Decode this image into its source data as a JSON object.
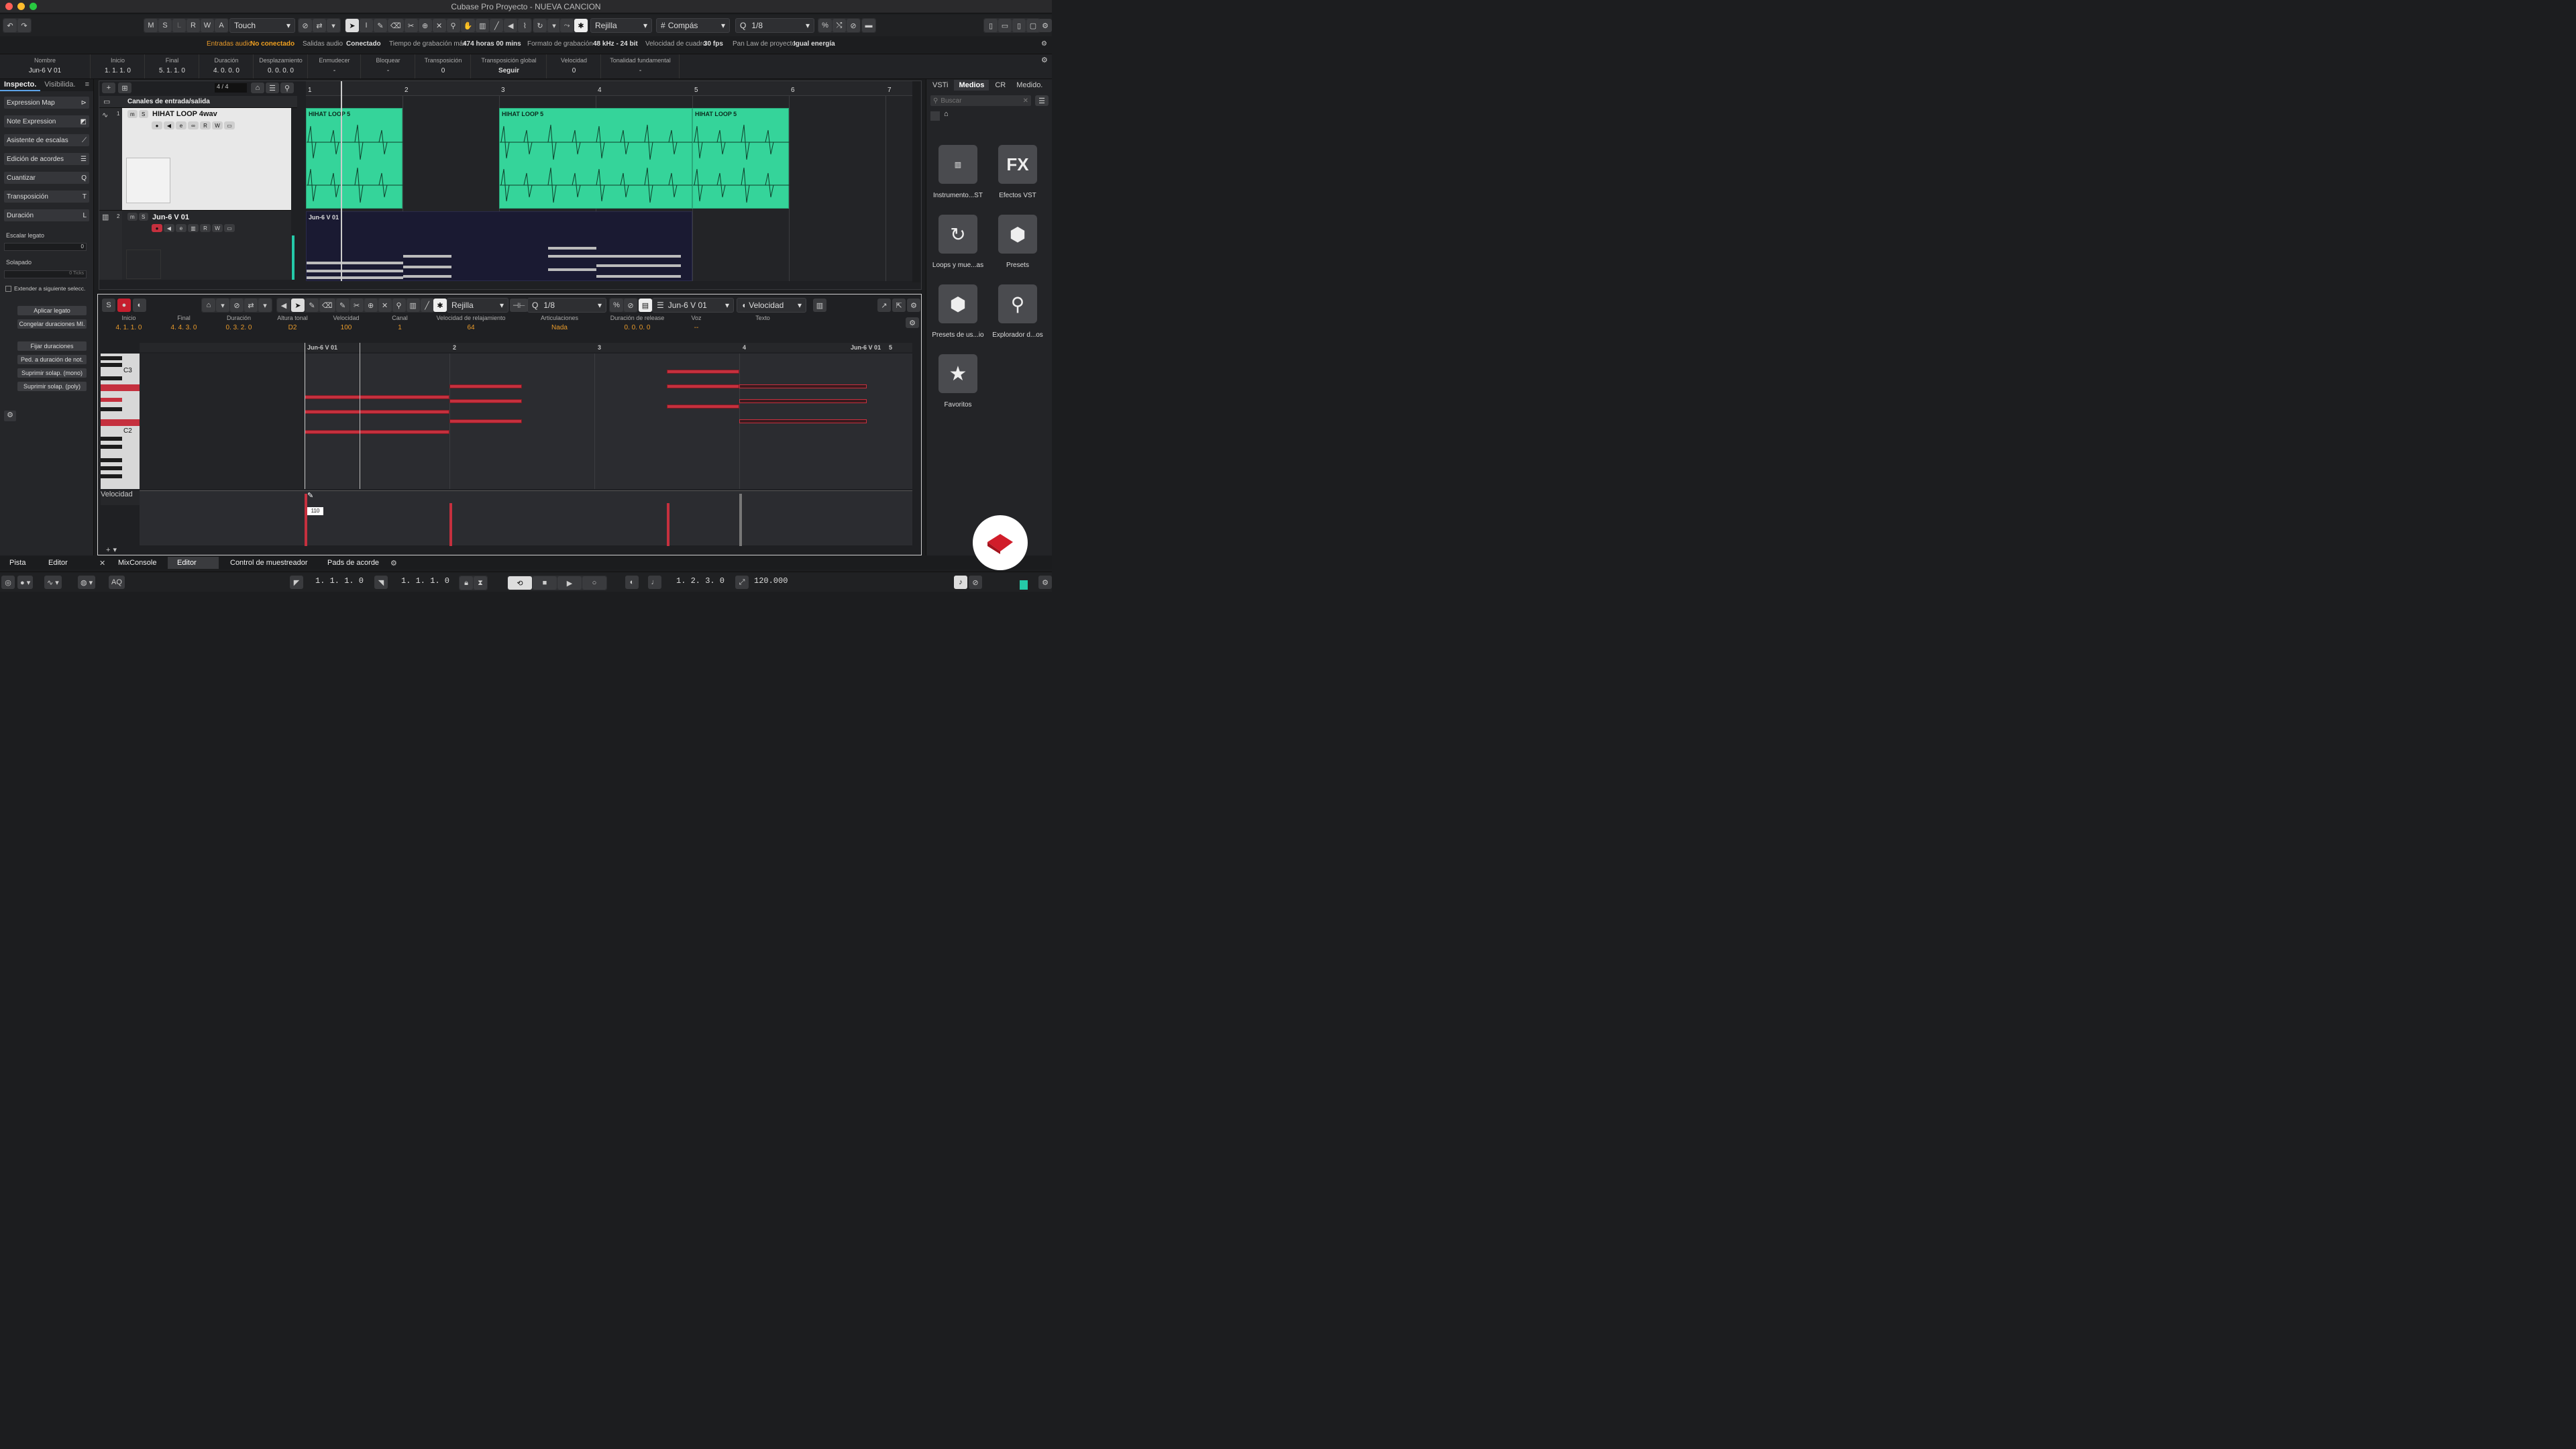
{
  "window": {
    "title": "Cubase Pro Proyecto - NUEVA CANCION"
  },
  "toolbar": {
    "mode_buttons": [
      "M",
      "S",
      "L",
      "R",
      "W",
      "A"
    ],
    "automation_mode": "Touch",
    "snap_type": "Rejilla",
    "grid_type": "Compás",
    "quantize": "1/8"
  },
  "status": {
    "in_label": "Entradas audio",
    "in_value": "No conectado",
    "out_label": "Salidas audio",
    "out_value": "Conectado",
    "rec_label": "Tiempo de grabación máx.",
    "rec_value": "474 horas 00 mins",
    "fmt_label": "Formato de grabación",
    "fmt_value": "48 kHz - 24 bit",
    "fps_label": "Velocidad de cuadro",
    "fps_value": "30 fps",
    "pan_label": "Pan Law de proyecto",
    "pan_value": "Igual energía"
  },
  "infoline": [
    {
      "label": "Nombre",
      "value": "Jun-6 V 01"
    },
    {
      "label": "Inicio",
      "value": "1. 1. 1.   0"
    },
    {
      "label": "Final",
      "value": "5. 1. 1.   0"
    },
    {
      "label": "Duración",
      "value": "4. 0. 0.   0"
    },
    {
      "label": "Desplazamiento",
      "value": "0. 0. 0.   0"
    },
    {
      "label": "Enmudecer",
      "value": "-"
    },
    {
      "label": "Bloquear",
      "value": "-"
    },
    {
      "label": "Transposición",
      "value": "0"
    },
    {
      "label": "Transposición global",
      "value": "Seguir"
    },
    {
      "label": "Velocidad",
      "value": "0"
    },
    {
      "label": "Tonalidad fundamental",
      "value": "-"
    }
  ],
  "inspector": {
    "tabs": [
      "Inspecto.",
      "Visibilida."
    ],
    "sections": [
      "Expression Map",
      "Note Expression",
      "Asistente de escalas",
      "Edición de acordes",
      "Cuantizar",
      "Transposición",
      "Duración"
    ],
    "scale_label": "Escalar legato",
    "scale_value": "0",
    "overlap_label": "Solapado",
    "overlap_value": "0 Ticks",
    "extend_label": "Extender a siguiente selecc.",
    "buttons": [
      "Aplicar legato",
      "Congelar duraciones MI.",
      "Fijar duraciones",
      "Ped. a duración de not.",
      "Suprimir solap. (mono)",
      "Suprimir solap. (poly)"
    ]
  },
  "project": {
    "signature": "4 / 4",
    "folder_label": "Canales de entrada/salida",
    "tracks": [
      {
        "num": "1",
        "name": "HIHAT LOOP 4wav"
      },
      {
        "num": "2",
        "name": "Jun-6 V 01"
      }
    ],
    "bars": [
      "1",
      "2",
      "3",
      "4",
      "5",
      "6",
      "7"
    ],
    "audio_clips": [
      "HIHAT LOOP 5",
      "HIHAT LOOP 5",
      "HIHAT LOOP 5"
    ],
    "midi_clip": "Jun-6 V 01"
  },
  "editor": {
    "snap": "Rejilla",
    "quantize": "1/8",
    "part": "Jun-6 V 01",
    "controller": "Velocidad",
    "info": [
      {
        "label": "Inicio",
        "value": "4. 1. 1.   0"
      },
      {
        "label": "Final",
        "value": "4. 4. 3.   0"
      },
      {
        "label": "Duración",
        "value": "0. 3. 2.   0"
      },
      {
        "label": "Altura tonal",
        "value": "D2"
      },
      {
        "label": "Velocidad",
        "value": "100"
      },
      {
        "label": "Canal",
        "value": "1"
      },
      {
        "label": "Velocidad de relajamiento",
        "value": "64"
      },
      {
        "label": "Articulaciones",
        "value": "Nada"
      },
      {
        "label": "Duración de release",
        "value": "0. 0. 0.   0"
      },
      {
        "label": "Voz",
        "value": "--"
      },
      {
        "label": "Texto",
        "value": ""
      }
    ],
    "ruler": [
      "Jun-6 V 01",
      "2",
      "3",
      "4",
      "Jun-6 V 01",
      "5"
    ],
    "keys": [
      "C3",
      "C2"
    ],
    "vel_lane": "Velocidad",
    "vel_tooltip": "110"
  },
  "mediabay": {
    "tabs": [
      "VSTi",
      "Medios",
      "CR",
      "Medido."
    ],
    "search": "Buscar",
    "tiles": [
      {
        "label": "Instrumento...ST",
        "icon": "piano-keys-icon"
      },
      {
        "label": "Efectos VST",
        "icon": "fx-icon",
        "glyph": "FX"
      },
      {
        "label": "Loops y mue...as",
        "icon": "loop-icon"
      },
      {
        "label": "Presets",
        "icon": "presets-icon"
      },
      {
        "label": "Presets de us...io",
        "icon": "user-presets-icon"
      },
      {
        "label": "Explorador d...os",
        "icon": "browser-icon"
      },
      {
        "label": "Favoritos",
        "icon": "star-icon"
      }
    ]
  },
  "bottom": {
    "left_tabs": [
      "Pista",
      "Editor"
    ],
    "zone_tabs": [
      "MixConsole",
      "Editor",
      "Control de muestreador",
      "Pads de acorde"
    ]
  },
  "transport": {
    "aq": "AQ",
    "left_locator": "1.  1.  1.    0",
    "right_locator": "1.  1.  1.    0",
    "position": "1.  2.  3.    0",
    "tempo": "120.000"
  },
  "colors": {
    "audio_clip": "#35d49a",
    "note": "#c5303e",
    "accent": "#5da3e8",
    "orange": "#e89a2a"
  }
}
